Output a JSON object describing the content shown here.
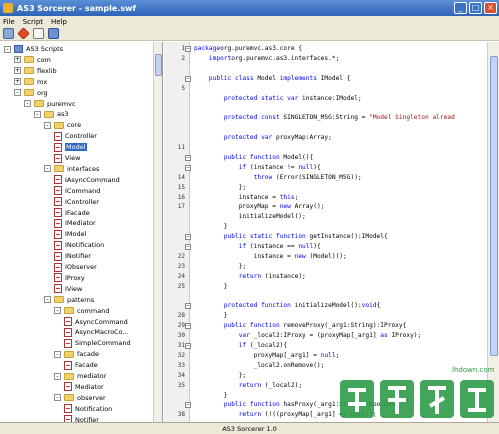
{
  "window": {
    "title": "AS3 Sorcerer - sample.swf"
  },
  "menu": [
    "File",
    "Script",
    "Help"
  ],
  "toolbar": [
    "open-icon",
    "decompile-icon",
    "copy-icon",
    "save-icon"
  ],
  "tree": [
    {
      "label": "AS3 Scripts",
      "depth": 0,
      "icon": "pkg",
      "exp": "-"
    },
    {
      "label": "com",
      "depth": 1,
      "icon": "folder",
      "exp": "+"
    },
    {
      "label": "flexlib",
      "depth": 1,
      "icon": "folder",
      "exp": "+"
    },
    {
      "label": "mx",
      "depth": 1,
      "icon": "folder",
      "exp": "+"
    },
    {
      "label": "org",
      "depth": 1,
      "icon": "folder",
      "exp": "-"
    },
    {
      "label": "puremvc",
      "depth": 2,
      "icon": "folder",
      "exp": "-"
    },
    {
      "label": "as3",
      "depth": 3,
      "icon": "folder",
      "exp": "-"
    },
    {
      "label": "core",
      "depth": 4,
      "icon": "folder",
      "exp": "-"
    },
    {
      "label": "Controller",
      "depth": 5,
      "icon": "file",
      "exp": ""
    },
    {
      "label": "Model",
      "depth": 5,
      "icon": "file",
      "exp": "",
      "selected": true
    },
    {
      "label": "View",
      "depth": 5,
      "icon": "file",
      "exp": ""
    },
    {
      "label": "interfaces",
      "depth": 4,
      "icon": "folder",
      "exp": "-"
    },
    {
      "label": "IAsyncCommand",
      "depth": 5,
      "icon": "file",
      "exp": ""
    },
    {
      "label": "ICommand",
      "depth": 5,
      "icon": "file",
      "exp": ""
    },
    {
      "label": "IController",
      "depth": 5,
      "icon": "file",
      "exp": ""
    },
    {
      "label": "IFacade",
      "depth": 5,
      "icon": "file",
      "exp": ""
    },
    {
      "label": "IMediator",
      "depth": 5,
      "icon": "file",
      "exp": ""
    },
    {
      "label": "IModel",
      "depth": 5,
      "icon": "file",
      "exp": ""
    },
    {
      "label": "INotification",
      "depth": 5,
      "icon": "file",
      "exp": ""
    },
    {
      "label": "INotifier",
      "depth": 5,
      "icon": "file",
      "exp": ""
    },
    {
      "label": "IObserver",
      "depth": 5,
      "icon": "file",
      "exp": ""
    },
    {
      "label": "IProxy",
      "depth": 5,
      "icon": "file",
      "exp": ""
    },
    {
      "label": "IView",
      "depth": 5,
      "icon": "file",
      "exp": ""
    },
    {
      "label": "patterns",
      "depth": 4,
      "icon": "folder",
      "exp": "-"
    },
    {
      "label": "command",
      "depth": 5,
      "icon": "folder",
      "exp": "-"
    },
    {
      "label": "AsyncCommand",
      "depth": 6,
      "icon": "file",
      "exp": ""
    },
    {
      "label": "AsyncMacroCo...",
      "depth": 6,
      "icon": "file",
      "exp": ""
    },
    {
      "label": "SimpleCommand",
      "depth": 6,
      "icon": "file",
      "exp": ""
    },
    {
      "label": "facade",
      "depth": 5,
      "icon": "folder",
      "exp": "-"
    },
    {
      "label": "Facade",
      "depth": 6,
      "icon": "file",
      "exp": ""
    },
    {
      "label": "mediator",
      "depth": 5,
      "icon": "folder",
      "exp": "-"
    },
    {
      "label": "Mediator",
      "depth": 6,
      "icon": "file",
      "exp": ""
    },
    {
      "label": "observer",
      "depth": 5,
      "icon": "folder",
      "exp": "-"
    },
    {
      "label": "Notification",
      "depth": 6,
      "icon": "file",
      "exp": ""
    },
    {
      "label": "Notifier",
      "depth": 6,
      "icon": "file",
      "exp": ""
    }
  ],
  "line_numbers": [
    "1",
    "2",
    "",
    "",
    "5",
    "",
    "",
    "",
    "",
    "",
    "11",
    "",
    "",
    "14",
    "15",
    "16",
    "17",
    "",
    "",
    "",
    "",
    "22",
    "23",
    "24",
    "25",
    "",
    "",
    "28",
    "29",
    "30",
    "31",
    "32",
    "33",
    "34",
    "35",
    "",
    "",
    "38"
  ],
  "code": [
    [
      [
        "kw",
        "package"
      ],
      [
        "",
        "org.puremvc.as3.core {"
      ]
    ],
    [
      [
        "",
        "    "
      ],
      [
        "kw",
        "import"
      ],
      [
        "",
        "org.puremvc.as3.interfaces.*;"
      ]
    ],
    [
      [
        "",
        ""
      ]
    ],
    [
      [
        "",
        "    "
      ],
      [
        "kw",
        "public class"
      ],
      [
        "",
        " Model "
      ],
      [
        "kw",
        "implements"
      ],
      [
        "",
        " IModel {"
      ]
    ],
    [
      [
        "",
        ""
      ]
    ],
    [
      [
        "",
        "        "
      ],
      [
        "kw",
        "protected static var"
      ],
      [
        "",
        " instance:IModel;"
      ]
    ],
    [
      [
        "",
        ""
      ]
    ],
    [
      [
        "",
        "        "
      ],
      [
        "kw",
        "protected const"
      ],
      [
        "",
        " SINGLETON_MSG:String = "
      ],
      [
        "str",
        "\"Model Singleton alread"
      ]
    ],
    [
      [
        "",
        ""
      ]
    ],
    [
      [
        "",
        "        "
      ],
      [
        "kw",
        "protected var"
      ],
      [
        "",
        " proxyMap:Array;"
      ]
    ],
    [
      [
        "",
        ""
      ]
    ],
    [
      [
        "",
        "        "
      ],
      [
        "kw",
        "public function"
      ],
      [
        "",
        " Model(){"
      ]
    ],
    [
      [
        "",
        "            "
      ],
      [
        "kw",
        "if"
      ],
      [
        "",
        " (instance != "
      ],
      [
        "kw",
        "null"
      ],
      [
        "",
        "){"
      ]
    ],
    [
      [
        "",
        "                "
      ],
      [
        "kw",
        "throw"
      ],
      [
        "",
        " (Error(SINGLETON_MSG));"
      ]
    ],
    [
      [
        "",
        "            };"
      ]
    ],
    [
      [
        "",
        "            instance = "
      ],
      [
        "kw",
        "this"
      ],
      [
        "",
        ";"
      ]
    ],
    [
      [
        "",
        "            proxyMap = "
      ],
      [
        "kw",
        "new"
      ],
      [
        "",
        " Array();"
      ]
    ],
    [
      [
        "",
        "            initializeModel();"
      ]
    ],
    [
      [
        "",
        "        }"
      ]
    ],
    [
      [
        "",
        "        "
      ],
      [
        "kw",
        "public static function"
      ],
      [
        "",
        " getInstance():IModel{"
      ]
    ],
    [
      [
        "",
        "            "
      ],
      [
        "kw",
        "if"
      ],
      [
        "",
        " (instance == "
      ],
      [
        "kw",
        "null"
      ],
      [
        "",
        "){"
      ]
    ],
    [
      [
        "",
        "                instance = "
      ],
      [
        "kw",
        "new"
      ],
      [
        "",
        " (Model)();"
      ]
    ],
    [
      [
        "",
        "            };"
      ]
    ],
    [
      [
        "",
        "            "
      ],
      [
        "kw",
        "return"
      ],
      [
        "",
        " (instance);"
      ]
    ],
    [
      [
        "",
        "        }"
      ]
    ],
    [
      [
        "",
        ""
      ]
    ],
    [
      [
        "",
        "        "
      ],
      [
        "kw",
        "protected function"
      ],
      [
        "",
        " initializeModel():"
      ],
      [
        "kw",
        "void"
      ],
      [
        "",
        "{"
      ]
    ],
    [
      [
        "",
        "        }"
      ]
    ],
    [
      [
        "",
        "        "
      ],
      [
        "kw",
        "public function"
      ],
      [
        "",
        " removeProxy(_arg1:String):IProxy{"
      ]
    ],
    [
      [
        "",
        "            "
      ],
      [
        "kw",
        "var"
      ],
      [
        "",
        " _local2:IProxy = (proxyMap[_arg1] "
      ],
      [
        "kw",
        "as"
      ],
      [
        "",
        " IProxy);"
      ]
    ],
    [
      [
        "",
        "            "
      ],
      [
        "kw",
        "if"
      ],
      [
        "",
        " (_local2){"
      ]
    ],
    [
      [
        "",
        "                proxyMap[_arg1] = "
      ],
      [
        "kw",
        "null"
      ],
      [
        "",
        ";"
      ]
    ],
    [
      [
        "",
        "                _local2.onRemove();"
      ]
    ],
    [
      [
        "",
        "            };"
      ]
    ],
    [
      [
        "",
        "            "
      ],
      [
        "kw",
        "return"
      ],
      [
        "",
        " (_local2);"
      ]
    ],
    [
      [
        "",
        "        }"
      ]
    ],
    [
      [
        "",
        "        "
      ],
      [
        "kw",
        "public function"
      ],
      [
        "",
        " hasProxy(_arg1:String):Boolean{"
      ]
    ],
    [
      [
        "",
        "            "
      ],
      [
        "kw",
        "return"
      ],
      [
        "",
        " (!((proxyMap[_arg1] == "
      ],
      [
        "kw",
        "null"
      ],
      [
        "",
        "));"
      ]
    ]
  ],
  "status": "AS3 Sorcerer 1.0",
  "watermark": {
    "logo_text": "领航下载",
    "url": "lhdown.com"
  }
}
